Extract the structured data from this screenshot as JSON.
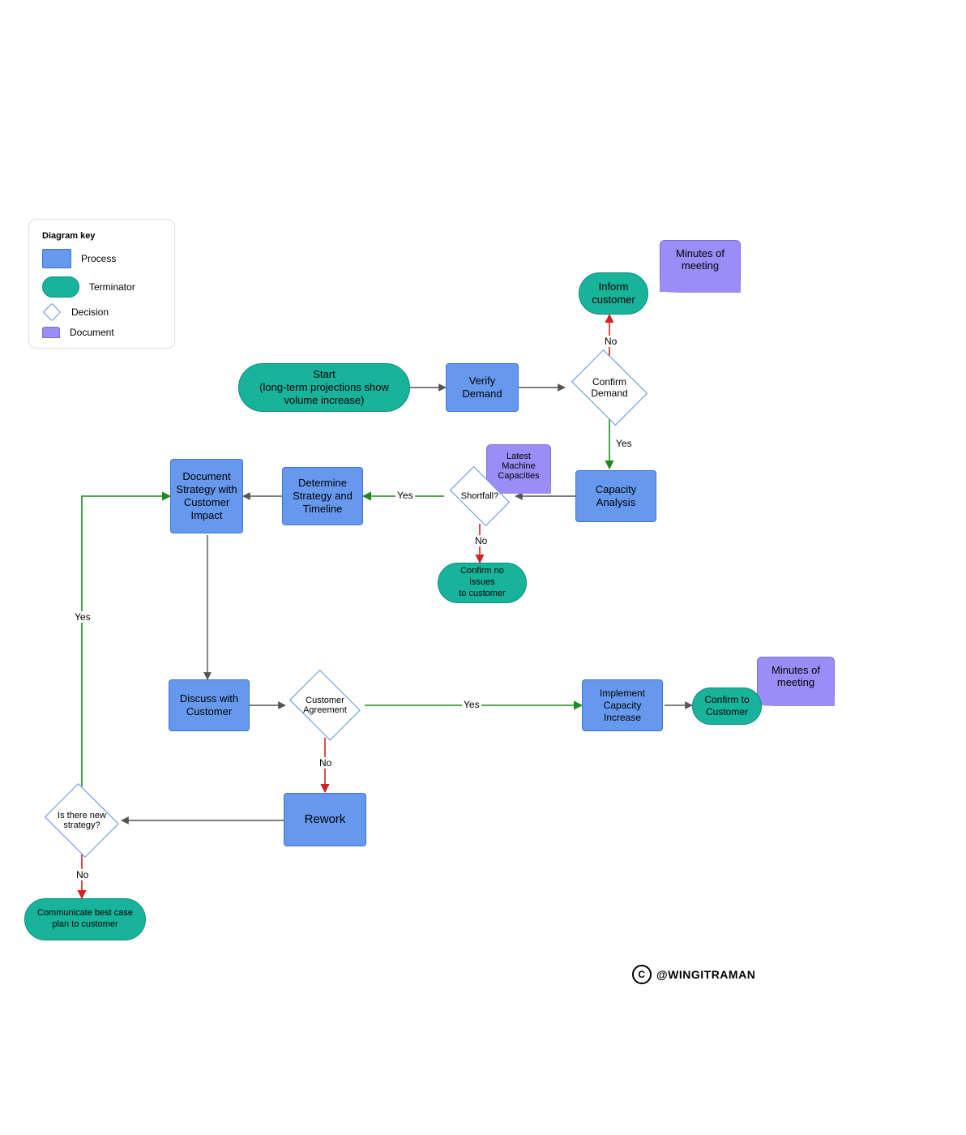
{
  "legend": {
    "title": "Diagram key",
    "items": [
      {
        "label": "Process",
        "kind": "process"
      },
      {
        "label": "Terminator",
        "kind": "terminator"
      },
      {
        "label": "Decision",
        "kind": "decision"
      },
      {
        "label": "Document",
        "kind": "document"
      }
    ]
  },
  "nodes": {
    "start": "Start\n(long-term projections show\nvolume increase)",
    "verify_demand": "Verify\nDemand",
    "confirm_demand": "Confirm\nDemand",
    "inform_customer": "Inform\ncustomer",
    "minutes_top": "Minutes of\nmeeting",
    "capacity_analysis": "Capacity\nAnalysis",
    "latest_capacities": "Latest\nMachine\nCapacities",
    "shortfall": "Shortfall?",
    "confirm_no_issues": "Confirm no issues\nto customer",
    "determine_strategy": "Determine\nStrategy and\nTimeline",
    "document_strategy": "Document\nStrategy with\nCustomer\nImpact",
    "discuss_customer": "Discuss with\nCustomer",
    "customer_agreement": "Customer\nAgreement",
    "implement_increase": "Implement\nCapacity\nIncrease",
    "confirm_to_customer": "Confirm to\nCustomer",
    "minutes_bottom": "Minutes of\nmeeting",
    "rework": "Rework",
    "new_strategy": "Is there new\nstrategy?",
    "communicate_plan": "Communicate best case\nplan to customer"
  },
  "edge_labels": {
    "confirm_demand_no": "No",
    "confirm_demand_yes": "Yes",
    "shortfall_yes": "Yes",
    "shortfall_no": "No",
    "customer_agreement_yes": "Yes",
    "customer_agreement_no": "No",
    "new_strategy_yes": "Yes",
    "new_strategy_no": "No"
  },
  "attribution": "@WINGITRAMAN",
  "colors": {
    "process": "#6699ee",
    "terminator": "#18b39b",
    "decision_border": "#5a8de0",
    "document": "#9b8df5",
    "arrow_default": "#555555",
    "arrow_yes": "#1a8a1a",
    "arrow_no": "#d42020"
  }
}
